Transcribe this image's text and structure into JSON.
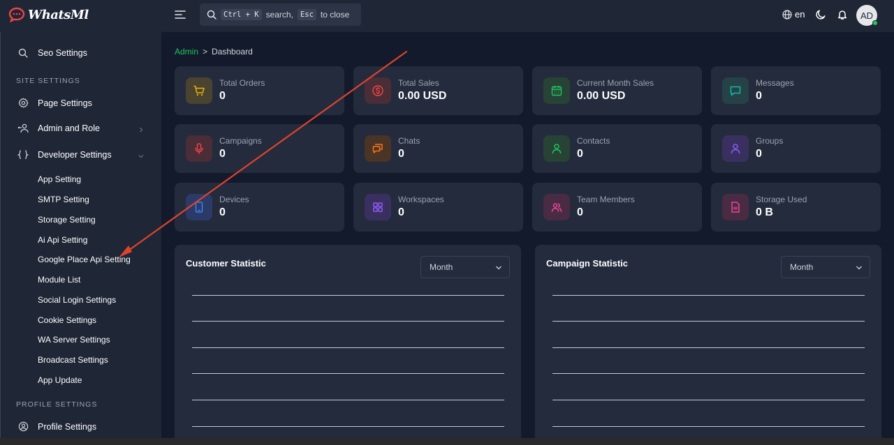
{
  "app": {
    "name": "WhatsMl"
  },
  "search": {
    "key_combo": "Ctrl + K",
    "text_search": "search,",
    "key_close": "Esc",
    "text_close": "to close"
  },
  "header": {
    "language": "en",
    "avatar_initials": "AD",
    "accent_color": "#22c55e"
  },
  "sidebar": {
    "seo_settings": "Seo Settings",
    "site_section": "SITE SETTINGS",
    "page_settings": "Page Settings",
    "admin_and_role": "Admin and Role",
    "developer_settings": "Developer Settings",
    "dev_items": [
      "App Setting",
      "SMTP Setting",
      "Storage Setting",
      "Ai Api Setting",
      "Google Place Api Setting",
      "Module List",
      "Social Login Settings",
      "Cookie Settings",
      "WA Server Settings",
      "Broadcast Settings",
      "App Update"
    ],
    "profile_section": "PROFILE SETTINGS",
    "profile_settings": "Profile Settings"
  },
  "breadcrumb": {
    "root": "Admin",
    "separator": ">",
    "current": "Dashboard"
  },
  "stats": [
    {
      "label": "Total Orders",
      "value": "0",
      "icon": "cart-icon",
      "color": "#eab308"
    },
    {
      "label": "Total Sales",
      "value": "0.00 USD",
      "icon": "dollar-icon",
      "color": "#ef4444"
    },
    {
      "label": "Current Month Sales",
      "value": "0.00 USD",
      "icon": "calendar-icon",
      "color": "#22c55e"
    },
    {
      "label": "Messages",
      "value": "0",
      "icon": "message-icon",
      "color": "#14b8a6"
    },
    {
      "label": "Campaigns",
      "value": "0",
      "icon": "microphone-icon",
      "color": "#ef4444"
    },
    {
      "label": "Chats",
      "value": "0",
      "icon": "chats-icon",
      "color": "#f97316"
    },
    {
      "label": "Contacts",
      "value": "0",
      "icon": "user-icon",
      "color": "#22c55e"
    },
    {
      "label": "Groups",
      "value": "0",
      "icon": "user-icon",
      "color": "#8b5cf6"
    },
    {
      "label": "Devices",
      "value": "0",
      "icon": "tablet-icon",
      "color": "#3b82f6"
    },
    {
      "label": "Workspaces",
      "value": "0",
      "icon": "grid-icon",
      "color": "#8b5cf6"
    },
    {
      "label": "Team Members",
      "value": "0",
      "icon": "users-icon",
      "color": "#ec4899"
    },
    {
      "label": "Storage Used",
      "value": "0 B",
      "icon": "file-icon",
      "color": "#ec4899"
    }
  ],
  "panels": [
    {
      "title": "Customer Statistic",
      "period": "Month"
    },
    {
      "title": "Campaign Statistic",
      "period": "Month"
    }
  ]
}
